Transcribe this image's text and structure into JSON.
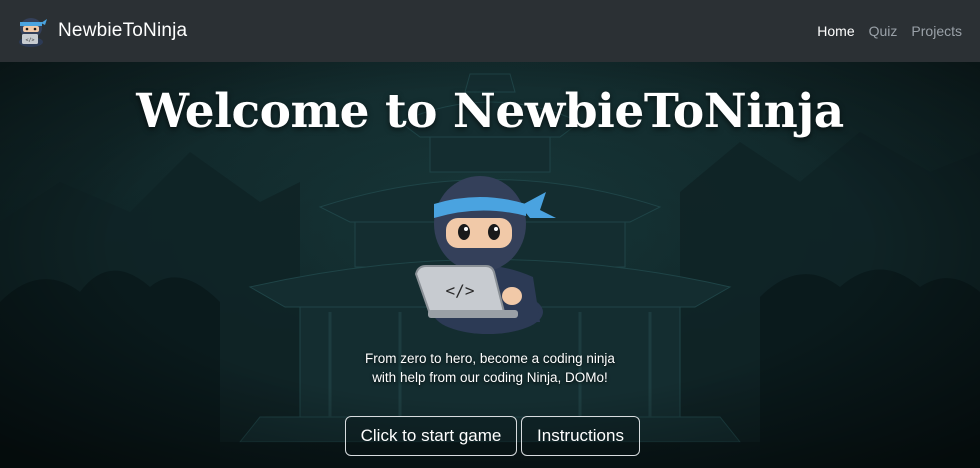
{
  "navbar": {
    "brand_name": "NewbieToNinja",
    "logo_icon": "ninja-logo-icon",
    "links": [
      {
        "label": "Home",
        "active": true
      },
      {
        "label": "Quiz",
        "active": false
      },
      {
        "label": "Projects",
        "active": false
      }
    ]
  },
  "hero": {
    "title": "Welcome to NewbieToNinja",
    "tagline_line1": "From zero to hero, become a coding ninja",
    "tagline_line2": "with help from our coding Ninja, DOMo!",
    "mascot_icon": "ninja-with-laptop-icon",
    "background": "pagoda-temple-night",
    "laptop_code_glyph": "</>"
  },
  "buttons": {
    "start_label": "Click to start game",
    "instructions_label": "Instructions"
  },
  "colors": {
    "navbar_bg": "#2b3034",
    "headband": "#4aa3e0",
    "hood": "#2c3a55",
    "hero_bg": "#0e2224"
  }
}
